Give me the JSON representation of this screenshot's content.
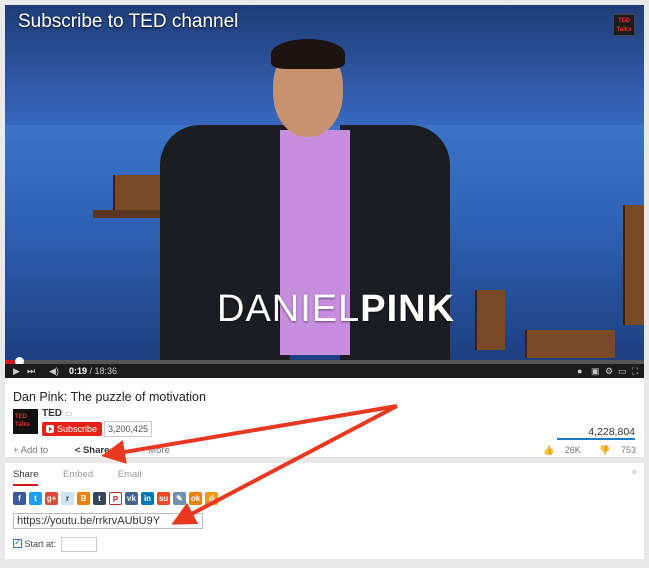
{
  "player": {
    "overlay_title": "Subscribe to TED channel",
    "ted_badge": "TED Talks",
    "speaker_first": "DANIEL",
    "speaker_last": "PINK",
    "current_time": "0:19",
    "duration": "/ 18:36",
    "progress_fraction": 0.017
  },
  "video": {
    "title": "Dan Pink: The puzzle of motivation",
    "channel": "TED",
    "subscribe_label": "Subscribe",
    "subscriber_count": "3,200,425",
    "views": "4,228,804",
    "actions": {
      "add_to": "Add to",
      "share": "Share",
      "more": "More"
    },
    "likes": "26K",
    "dislikes": "753"
  },
  "share": {
    "tabs": [
      "Share",
      "Embed",
      "Email"
    ],
    "close": "×",
    "social_icons": [
      "facebook-icon",
      "twitter-icon",
      "google-plus-icon",
      "reddit-icon",
      "blogger-icon",
      "tumblr-icon",
      "pinterest-icon",
      "vk-icon",
      "linkedin-icon",
      "stumbleupon-icon",
      "livejournal-icon",
      "odnoklassniki-icon",
      "digg-icon"
    ],
    "url": "https://youtu.be/rrkrvAUbU9Y",
    "start_at_label": "Start at:"
  },
  "colors": {
    "accent": "#cc181e",
    "subscribe": "#e62117",
    "arrow": "#e8381f",
    "link_blue": "#167ac6"
  }
}
